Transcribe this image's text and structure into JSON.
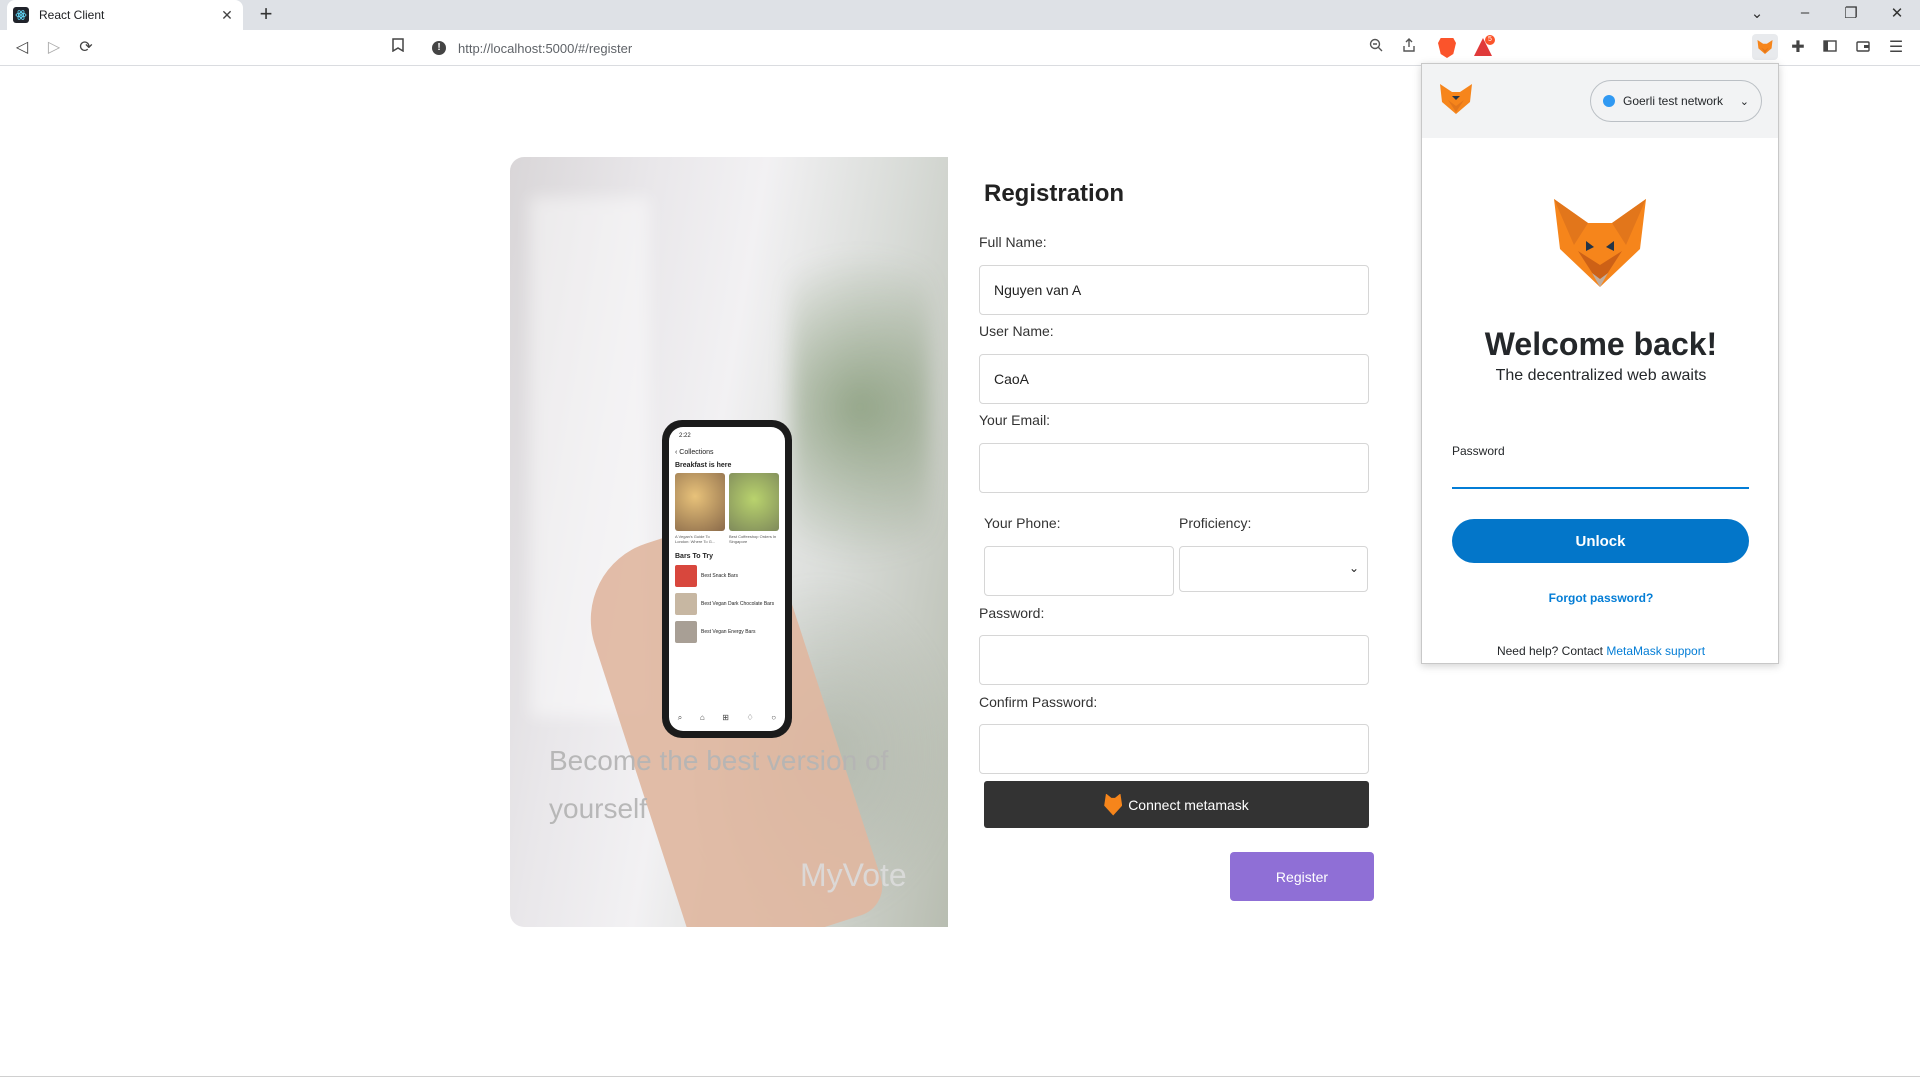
{
  "browser": {
    "tab_title": "React Client",
    "tab_close": "✕",
    "new_tab": "+",
    "url": "http://localhost:5000/#/register",
    "reward_count": "5"
  },
  "hero": {
    "phone": {
      "time": "2:22",
      "back_label": "Collections",
      "section1": "Breakfast is here",
      "caption1": "A Vegan's Guide To London: Where To G...",
      "caption2": "Best Coffeeshop Orders In Singapore",
      "section2": "Bars To Try",
      "row1": "Best Snack Bars",
      "row2": "Best Vegan Dark Chocolate Bars",
      "row3": "Best Vegan Energy Bars"
    },
    "quote": "Become the best version of yourself",
    "brand": "MyVote"
  },
  "form": {
    "title": "Registration",
    "full_name_label": "Full Name:",
    "full_name_value": "Nguyen van A",
    "user_name_label": "User Name:",
    "user_name_value": "CaoA",
    "email_label": "Your Email:",
    "email_value": "",
    "phone_label": "Your Phone:",
    "phone_value": "",
    "proficiency_label": "Proficiency:",
    "proficiency_value": "",
    "password_label": "Password:",
    "password_value": "",
    "confirm_password_label": "Confirm Password:",
    "confirm_password_value": "",
    "connect_button": "Connect metamask",
    "register_button": "Register"
  },
  "metamask": {
    "network": "Goerli test network",
    "welcome": "Welcome back!",
    "subtitle": "The decentralized web awaits",
    "password_label": "Password",
    "unlock_button": "Unlock",
    "forgot_password": "Forgot password?",
    "help_prefix": "Need help? Contact ",
    "help_link": "MetaMask support"
  },
  "colors": {
    "register_button": "#8f6fd6",
    "connect_button": "#333333",
    "metamask_blue": "#037dd6",
    "network_dot": "#3099f2"
  }
}
